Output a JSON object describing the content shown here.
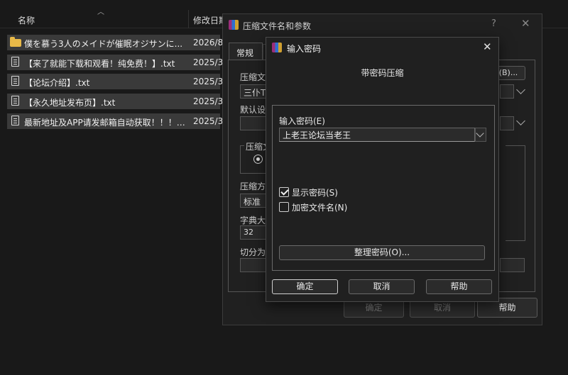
{
  "explorer": {
    "columns": {
      "name": "名称",
      "date": "修改日期"
    },
    "files": [
      {
        "name": "僕を慕う3人のメイドが催眠オジサンに...",
        "date": "2026/8",
        "icon": "folder-icon"
      },
      {
        "name": "【来了就能下载和观看！纯免费！】.txt",
        "date": "2025/3",
        "icon": "file-icon"
      },
      {
        "name": "【论坛介绍】.txt",
        "date": "2025/3",
        "icon": "file-icon"
      },
      {
        "name": "【永久地址发布页】.txt",
        "date": "2025/3",
        "icon": "file-icon"
      },
      {
        "name": "最新地址及APP请发邮箱自动获取！！！....",
        "date": "2025/3",
        "icon": "file-icon"
      }
    ]
  },
  "archive_dialog": {
    "title": "压缩文件名和参数",
    "help": "?",
    "close": "✕",
    "tab_general": "常规",
    "label_archive_name": "压缩文",
    "archive_name_value": "三仆TR",
    "browse_button": "(B)...",
    "label_default": "默认设",
    "label_format": "压缩文",
    "label_method": "压缩方",
    "method_value": "标准",
    "label_dict": "字典大",
    "dict_value": "32",
    "label_split": "切分为",
    "ok": "确定",
    "cancel": "取消",
    "help_button": "帮助"
  },
  "password_dialog": {
    "title": "输入密码",
    "close": "✕",
    "heading": "带密码压缩",
    "password_label": "输入密码(E)",
    "password_value": "上老王论坛当老王",
    "show_password": "显示密码(S)",
    "show_password_checked": true,
    "encrypt_names": "加密文件名(N)",
    "encrypt_names_checked": false,
    "organize_button": "整理密码(O)...",
    "ok": "确定",
    "cancel": "取消",
    "help": "帮助"
  }
}
